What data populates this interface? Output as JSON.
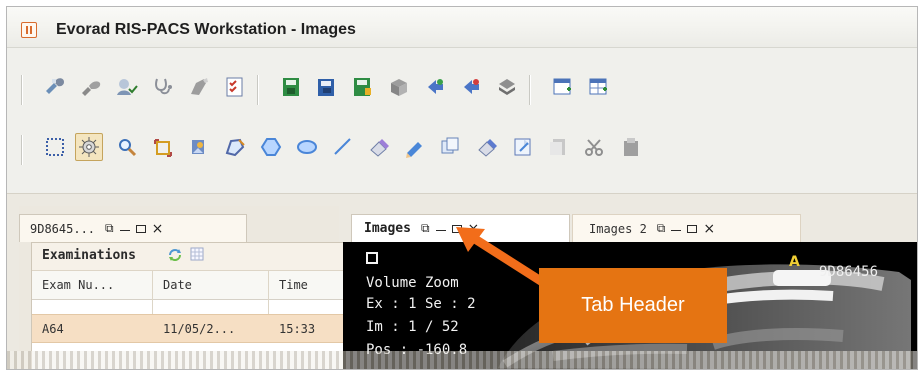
{
  "window": {
    "title": "Evorad RIS-PACS Workstation - Images"
  },
  "toolbars": {
    "row1": [
      {
        "icon": "wrench-icon"
      },
      {
        "icon": "tool-icon"
      },
      {
        "icon": "user-check-icon"
      },
      {
        "icon": "stethoscope-icon"
      },
      {
        "icon": "pen-icon"
      },
      {
        "icon": "checklist-icon"
      },
      {
        "icon": "save-icon"
      },
      {
        "icon": "save-all-icon"
      },
      {
        "icon": "save-color-icon"
      },
      {
        "icon": "box-icon"
      },
      {
        "icon": "transfer-icon"
      },
      {
        "icon": "export-icon"
      },
      {
        "icon": "stack-icon"
      },
      {
        "icon": "new-window-icon"
      },
      {
        "icon": "grid-window-icon"
      }
    ],
    "row2": [
      {
        "icon": "select-rect-icon"
      },
      {
        "icon": "settings-icon"
      },
      {
        "icon": "magnifier-icon"
      },
      {
        "icon": "crop-icon"
      },
      {
        "icon": "image-tool-icon"
      },
      {
        "icon": "polygon-tool-icon"
      },
      {
        "icon": "hexagon-icon"
      },
      {
        "icon": "ellipse-icon"
      },
      {
        "icon": "line-icon"
      },
      {
        "icon": "eraser-icon"
      },
      {
        "icon": "pencil-icon"
      },
      {
        "icon": "copy-icon"
      },
      {
        "icon": "eraser-2-icon"
      },
      {
        "icon": "document-icon"
      },
      {
        "icon": "pages-icon"
      },
      {
        "icon": "scissors-icon"
      },
      {
        "icon": "paste-icon"
      }
    ]
  },
  "left_pane": {
    "tab_label": "9D8645...",
    "examinations_label": "Examinations",
    "columns": [
      "Exam Nu...",
      "Date",
      "Time"
    ],
    "rows": [
      [
        "A64",
        "11/05/2...",
        "15:33"
      ]
    ]
  },
  "center_pane": {
    "tabs": [
      {
        "label": "Images",
        "active": true
      },
      {
        "label": "Images 2",
        "active": false
      }
    ],
    "overlay": {
      "line1": "Volume Zoom",
      "line2": "Ex : 1   Se : 2",
      "line3": "Im : 1 / 52",
      "line4": "Pos : -160.8"
    },
    "anatomy_label": "A",
    "patient_id": "9D86456"
  },
  "annotation": {
    "label": "Tab Header"
  },
  "colors": {
    "title_text": "#1f1f1f",
    "tab_border": "#cfc8bb",
    "selected_row": "#f6dfc4",
    "annotation": "#e57412",
    "arrow": "#f26d1a",
    "overlay_text": "#f2f2f2",
    "anatomy_label": "#f0cf35"
  }
}
